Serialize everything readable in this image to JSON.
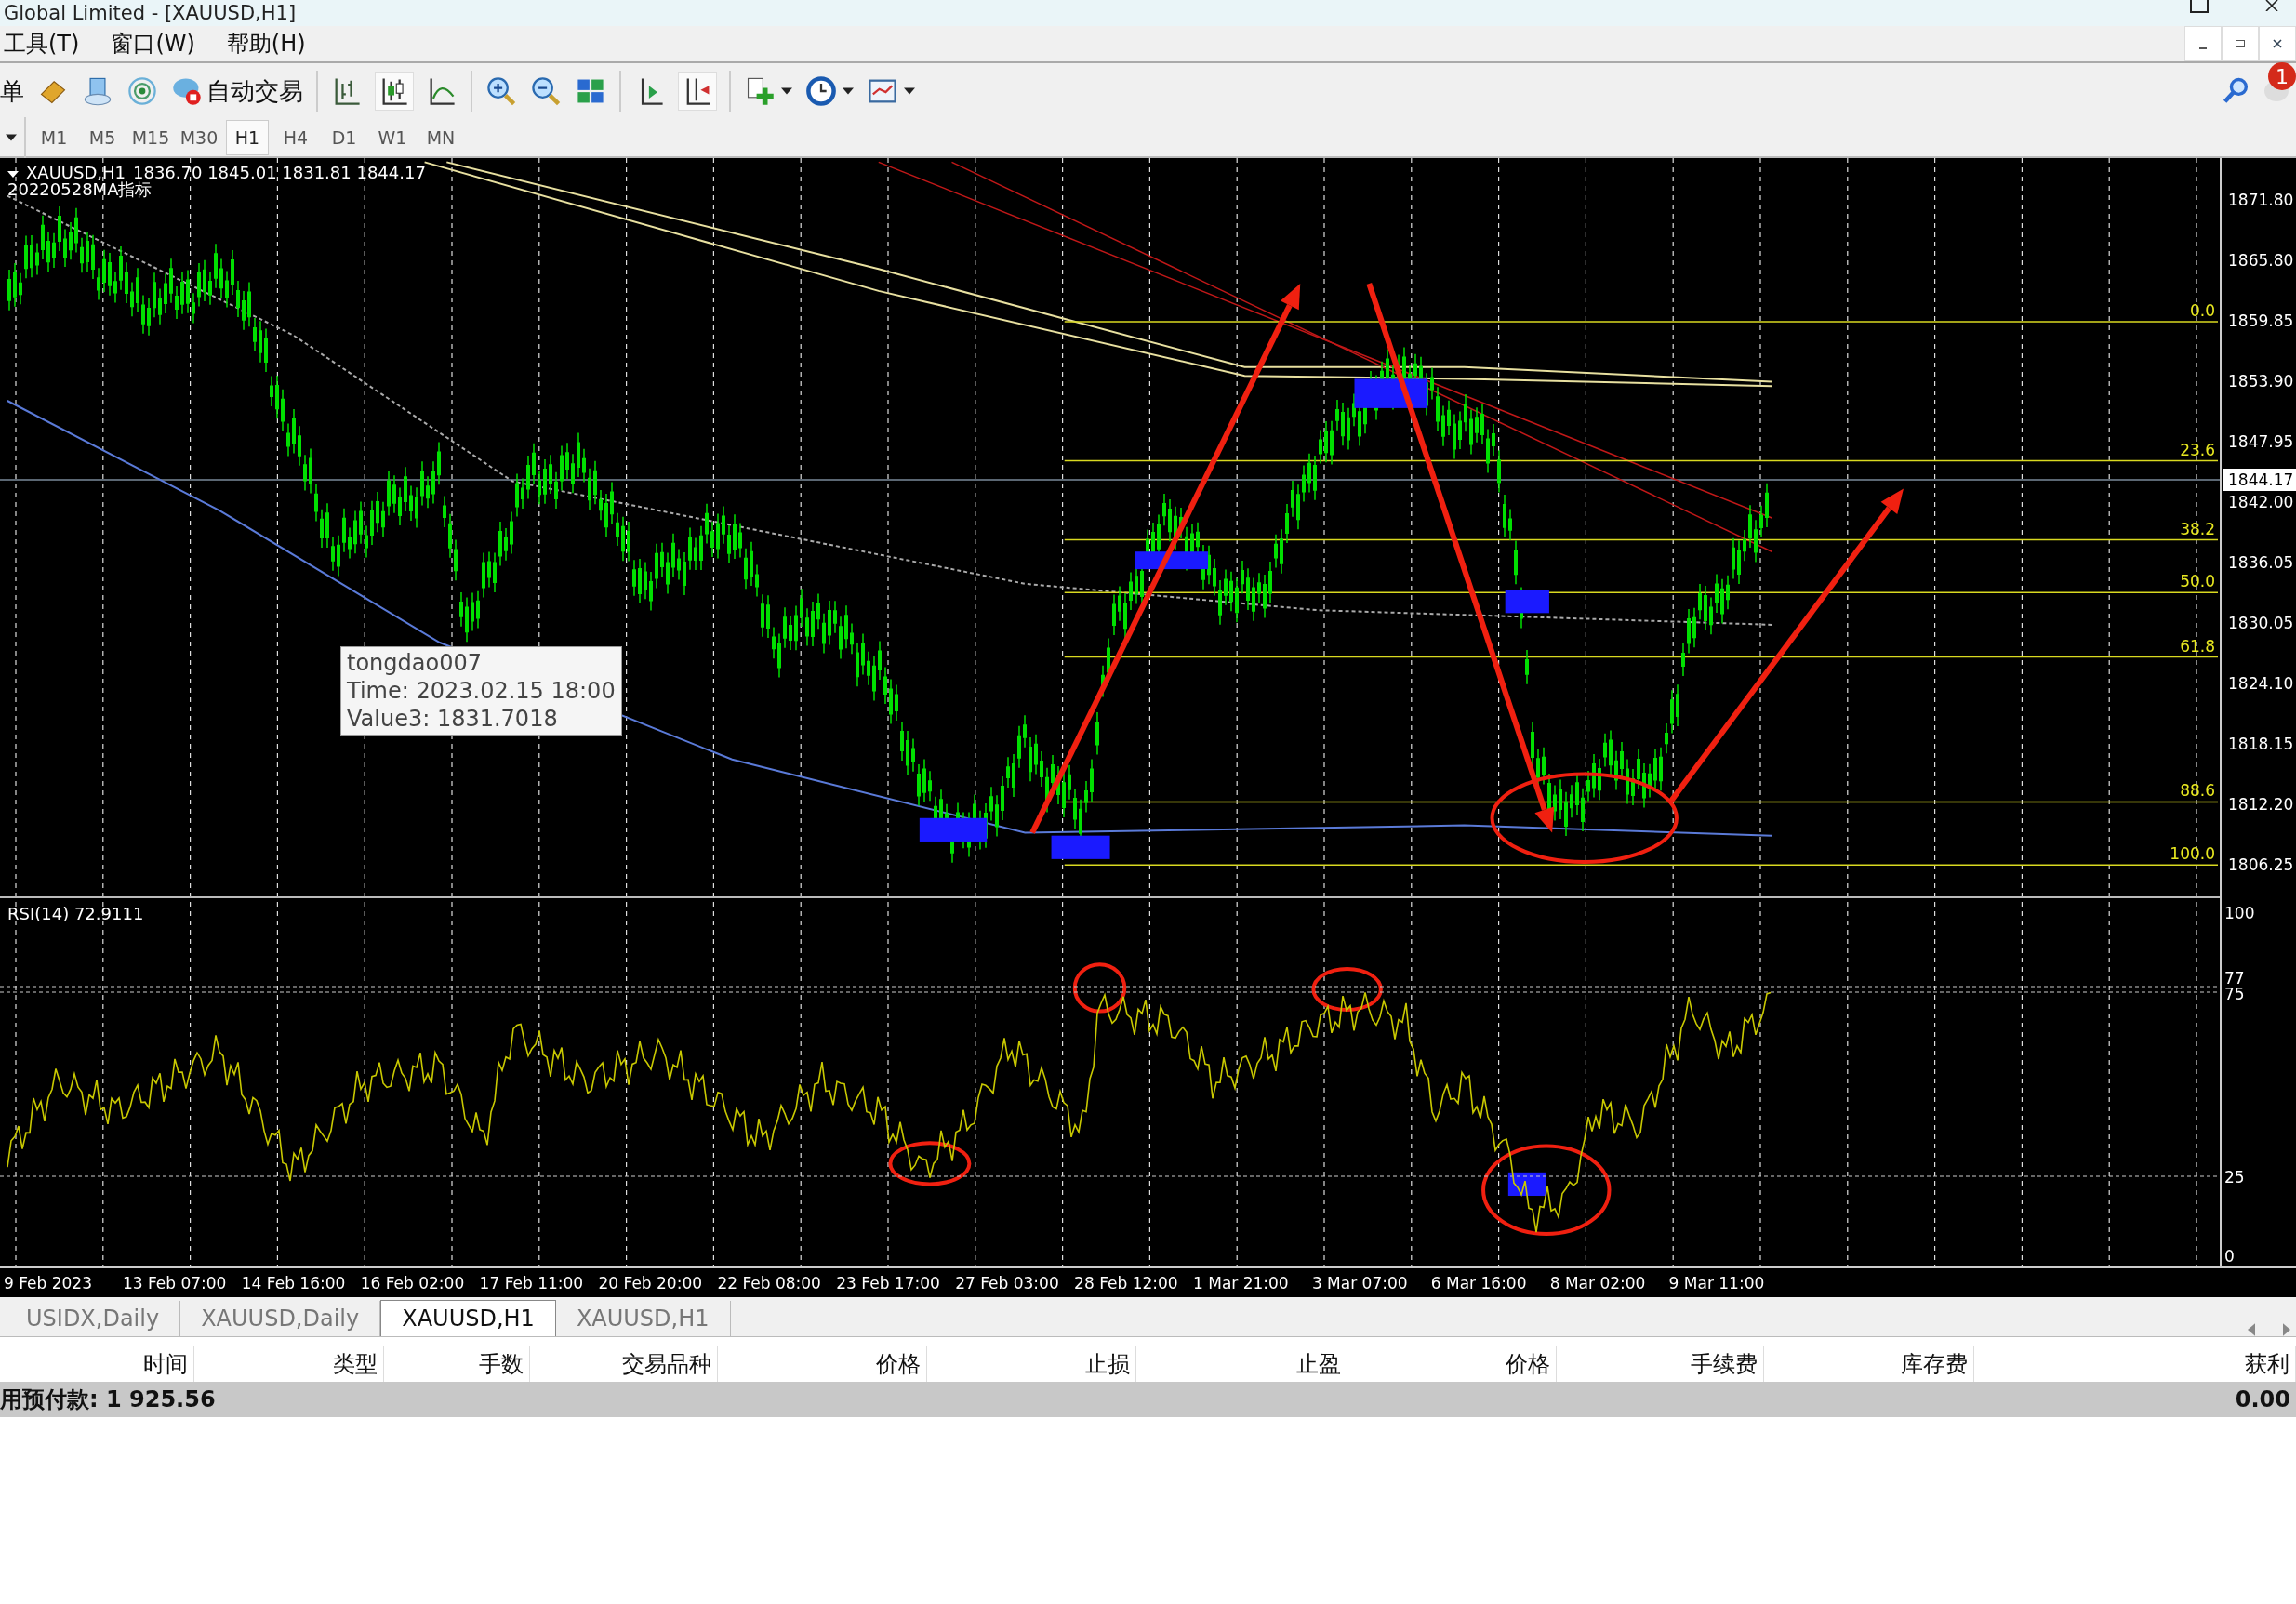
{
  "window": {
    "title": "Global Limited - [XAUUSD,H1]"
  },
  "menu": [
    {
      "label": "工具(T)"
    },
    {
      "label": "窗口(W)"
    },
    {
      "label": "帮助(H)"
    }
  ],
  "toolbar": {
    "order_label": "单",
    "auto_trade_label": "自动交易",
    "notification_count": "1"
  },
  "timeframes": [
    {
      "label": "M1",
      "selected": false
    },
    {
      "label": "M5",
      "selected": false
    },
    {
      "label": "M15",
      "selected": false
    },
    {
      "label": "M30",
      "selected": false
    },
    {
      "label": "H1",
      "selected": true
    },
    {
      "label": "H4",
      "selected": false
    },
    {
      "label": "D1",
      "selected": false
    },
    {
      "label": "W1",
      "selected": false
    },
    {
      "label": "MN",
      "selected": false
    }
  ],
  "chart": {
    "symbol": "XAUUSD,H1",
    "ohlc": "1836.70 1845.01 1831.81 1844.17",
    "indicator": "20220528MA指标",
    "price_ticks": [
      "1871.80",
      "1865.80",
      "1859.85",
      "1853.90",
      "1847.95",
      "1842.00",
      "1836.05",
      "1830.05",
      "1824.10",
      "1818.15",
      "1812.20",
      "1806.25"
    ],
    "current_price": "1844.17",
    "fib_levels": [
      "0.0",
      "23.6",
      "38.2",
      "50.0",
      "61.8",
      "88.6",
      "100.0"
    ],
    "tooltip": [
      "tongdao007",
      "Time: 2023.02.15 18:00",
      "Value3: 1831.7018"
    ],
    "rsi": {
      "label": "RSI(14) 72.9111",
      "ticks": [
        "100",
        "77",
        "75",
        "25",
        "0"
      ]
    },
    "time_ticks": [
      "9 Feb 2023",
      "13 Feb 07:00",
      "14 Feb 16:00",
      "16 Feb 02:00",
      "17 Feb 11:00",
      "20 Feb 20:00",
      "22 Feb 08:00",
      "23 Feb 17:00",
      "27 Feb 03:00",
      "28 Feb 12:00",
      "1 Mar 21:00",
      "3 Mar 07:00",
      "6 Mar 16:00",
      "8 Mar 02:00",
      "9 Mar 11:00"
    ]
  },
  "chart_tabs": [
    {
      "label": "USIDX,Daily",
      "selected": false
    },
    {
      "label": "XAUUSD,Daily",
      "selected": false
    },
    {
      "label": "XAUUSD,H1",
      "selected": true
    },
    {
      "label": "XAUUSD,H1",
      "selected": false
    }
  ],
  "table": {
    "columns": [
      "时间",
      "类型",
      "手数",
      "交易品种",
      "价格",
      "止损",
      "止盈",
      "价格",
      "手续费",
      "库存费",
      "获利"
    ]
  },
  "summary": {
    "label": "用预付款: 1 925.56",
    "profit": "0.00"
  }
}
